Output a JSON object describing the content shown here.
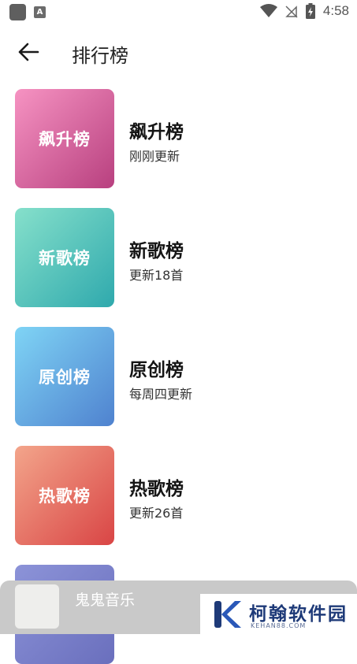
{
  "status_bar": {
    "time": "4:58"
  },
  "app_bar": {
    "title": "排行榜"
  },
  "rankings": [
    {
      "cover_label": "飙升榜",
      "title": "飙升榜",
      "subtitle": "刚刚更新",
      "gradient": [
        "#f693c2",
        "#b8407f"
      ]
    },
    {
      "cover_label": "新歌榜",
      "title": "新歌榜",
      "subtitle": "更新18首",
      "gradient": [
        "#86e0cb",
        "#2fa9ad"
      ]
    },
    {
      "cover_label": "原创榜",
      "title": "原创榜",
      "subtitle": "每周四更新",
      "gradient": [
        "#7fd4f5",
        "#4f82cf"
      ]
    },
    {
      "cover_label": "热歌榜",
      "title": "热歌榜",
      "subtitle": "更新26首",
      "gradient": [
        "#f3a58b",
        "#d94545"
      ]
    },
    {
      "cover_label": "",
      "title": "",
      "subtitle": "",
      "gradient": [
        "#8c93d8",
        "#6a6fbd"
      ]
    }
  ],
  "mini_player": {
    "title": "鬼鬼音乐"
  },
  "watermark": {
    "text": "柯翰软件园",
    "subtext": "KEHAN88.COM",
    "color": "#1e3a78"
  }
}
